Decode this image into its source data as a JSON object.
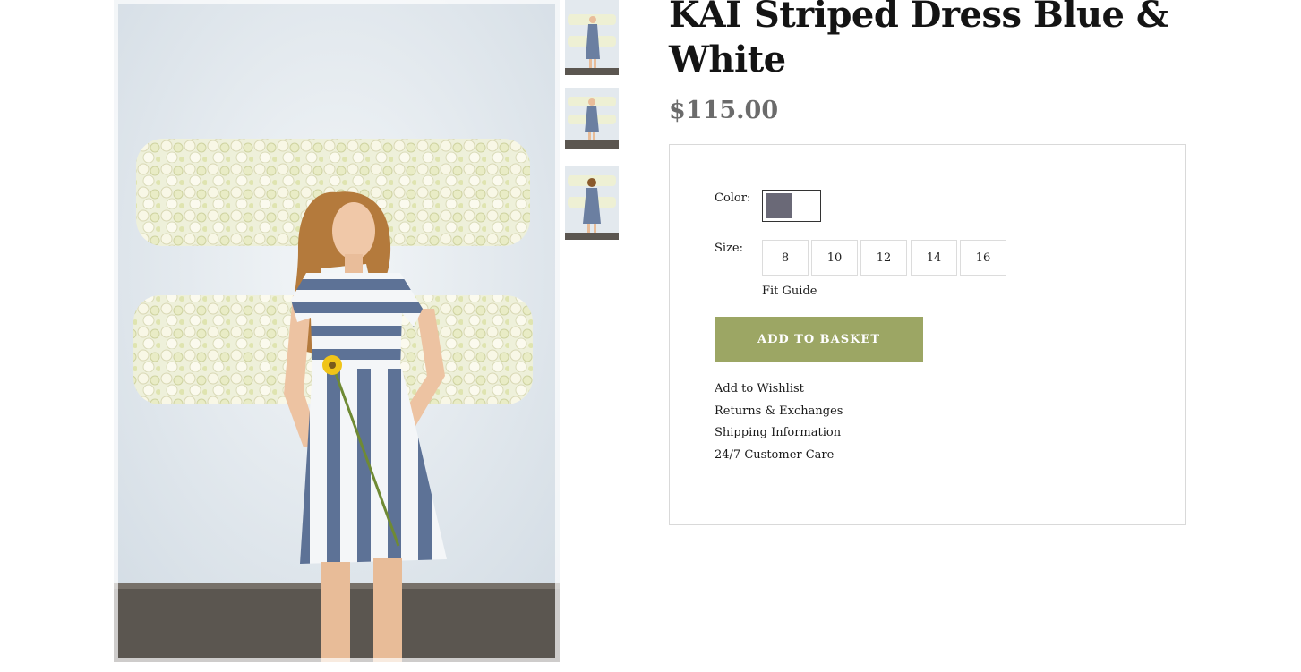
{
  "product": {
    "title": "KAI Striped Dress Blue & White",
    "price": "$115.00"
  },
  "images": {
    "main": "product-photo",
    "thumbnails": [
      "thumbnail-front",
      "thumbnail-full",
      "thumbnail-back"
    ]
  },
  "options": {
    "color_label": "Color:",
    "color_swatch_hex": "#6a6977",
    "size_label": "Size:",
    "sizes": [
      "8",
      "10",
      "12",
      "14",
      "16"
    ],
    "fit_guide": "Fit Guide"
  },
  "actions": {
    "add_to_basket": "ADD TO BASKET",
    "button_color": "#9ca664"
  },
  "links": [
    "Add to Wishlist",
    "Returns & Exchanges",
    "Shipping Information",
    "24/7 Customer Care"
  ]
}
